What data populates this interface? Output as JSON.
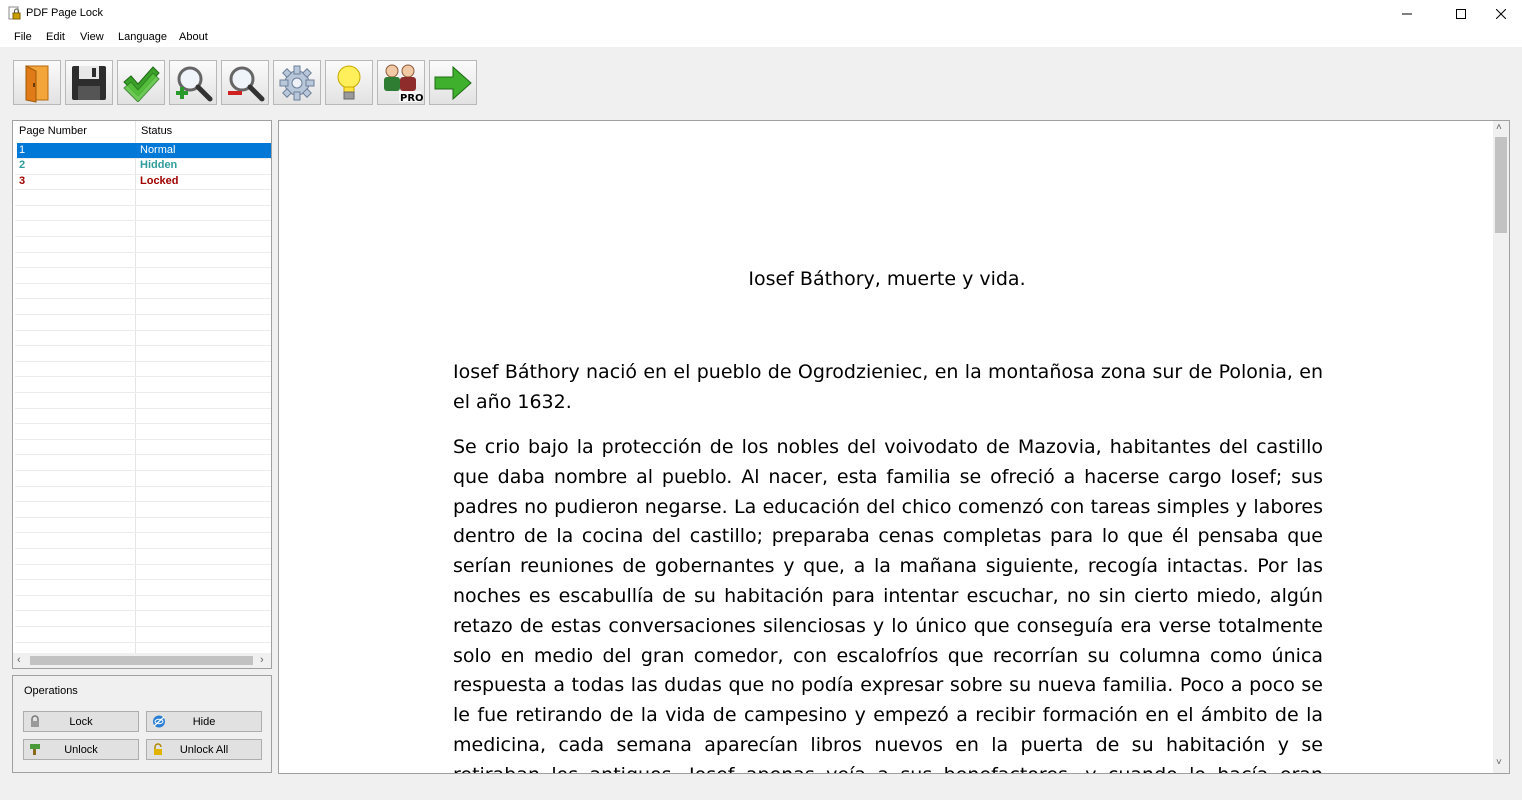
{
  "window": {
    "title": "PDF Page Lock"
  },
  "menu": [
    "File",
    "Edit",
    "View",
    "Language",
    "About"
  ],
  "toolbar": {
    "buttons": [
      "open-icon",
      "save-icon",
      "apply-checkmark-icon",
      "zoom-in-icon",
      "zoom-out-icon",
      "settings-gear-icon",
      "tips-bulb-icon",
      "pro-users-icon",
      "next-arrow-icon"
    ],
    "pro_badge": "PRO"
  },
  "pages": {
    "headers": [
      "Page Number",
      "Status"
    ],
    "rows": [
      {
        "number": "1",
        "status": "Normal",
        "color": "#ffffff"
      },
      {
        "number": "2",
        "status": "Hidden",
        "color": "#2e9c9c"
      },
      {
        "number": "3",
        "status": "Locked",
        "color": "#a00000"
      }
    ]
  },
  "operations": {
    "title": "Operations",
    "lock": "Lock",
    "hide": "Hide",
    "unlock": "Unlock",
    "unlock_all": "Unlock All"
  },
  "document": {
    "title": "Iosef Báthory, muerte y vida.",
    "p1": "Iosef Báthory nació en el pueblo de Ogrodzieniec, en la montañosa zona sur de Polonia, en el año 1632.",
    "p2": "Se crio bajo la protección de los nobles del voivodato de Mazovia, habitantes del castillo que daba nombre al pueblo. Al nacer, esta familia se ofreció a hacerse cargo Iosef; sus padres no pudieron negarse. La educación del chico comenzó con tareas simples y labores dentro de la cocina del castillo; preparaba cenas completas para lo que él pensaba que serían reuniones de gobernantes y que, a la mañana siguiente, recogía intactas. Por las noches es escabullía de su habitación para intentar escuchar, no sin cierto miedo, algún retazo de estas conversaciones silenciosas y lo único que conseguía era verse totalmente solo en medio del gran comedor, con escalofríos que recorrían su columna como única respuesta a todas las dudas que no podía expresar sobre su nueva familia. Poco a poco se le fue retirando de la vida de campesino y empezó a recibir formación en el ámbito de la medicina, cada semana aparecían libros nuevos en la puerta de su habitación y se retiraban los antiguos. Iosef apenas veía a sus benefactores, y cuando lo hacía eran encuentros fríos y distantes. La relación con sus padres biológicos se fue"
  },
  "colors": {
    "selection": "#0078d7",
    "hidden": "#2e9c9c",
    "locked": "#a00000"
  }
}
